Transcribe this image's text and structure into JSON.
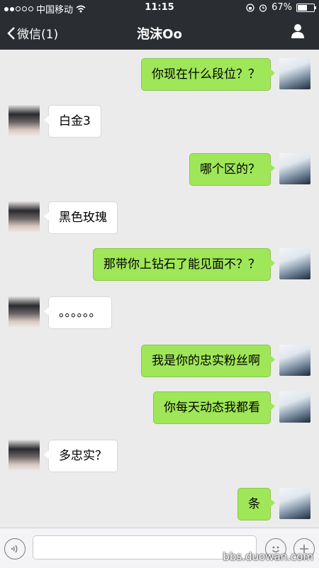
{
  "status_bar": {
    "carrier": "中国移动",
    "time": "11:15",
    "battery": "67%",
    "battery_level": 0.67
  },
  "nav": {
    "back_label": "微信(1)",
    "title": "泡沫Oo"
  },
  "messages": [
    {
      "from": "me",
      "text": "你现在什么段位？？"
    },
    {
      "from": "other",
      "text": "白金3"
    },
    {
      "from": "me",
      "text": "哪个区的？"
    },
    {
      "from": "other",
      "text": "黑色玫瑰"
    },
    {
      "from": "me",
      "text": "那带你上钻石了能见面不？？"
    },
    {
      "from": "other",
      "text": "。。。。。。"
    },
    {
      "from": "me",
      "text": "我是你的忠实粉丝啊"
    },
    {
      "from": "me",
      "text": "你每天动态我都看"
    },
    {
      "from": "other",
      "text": "多忠实？"
    },
    {
      "from": "me",
      "text": "条"
    }
  ],
  "input": {
    "value": "",
    "placeholder": ""
  },
  "watermark": "bbs.duowan.com"
}
